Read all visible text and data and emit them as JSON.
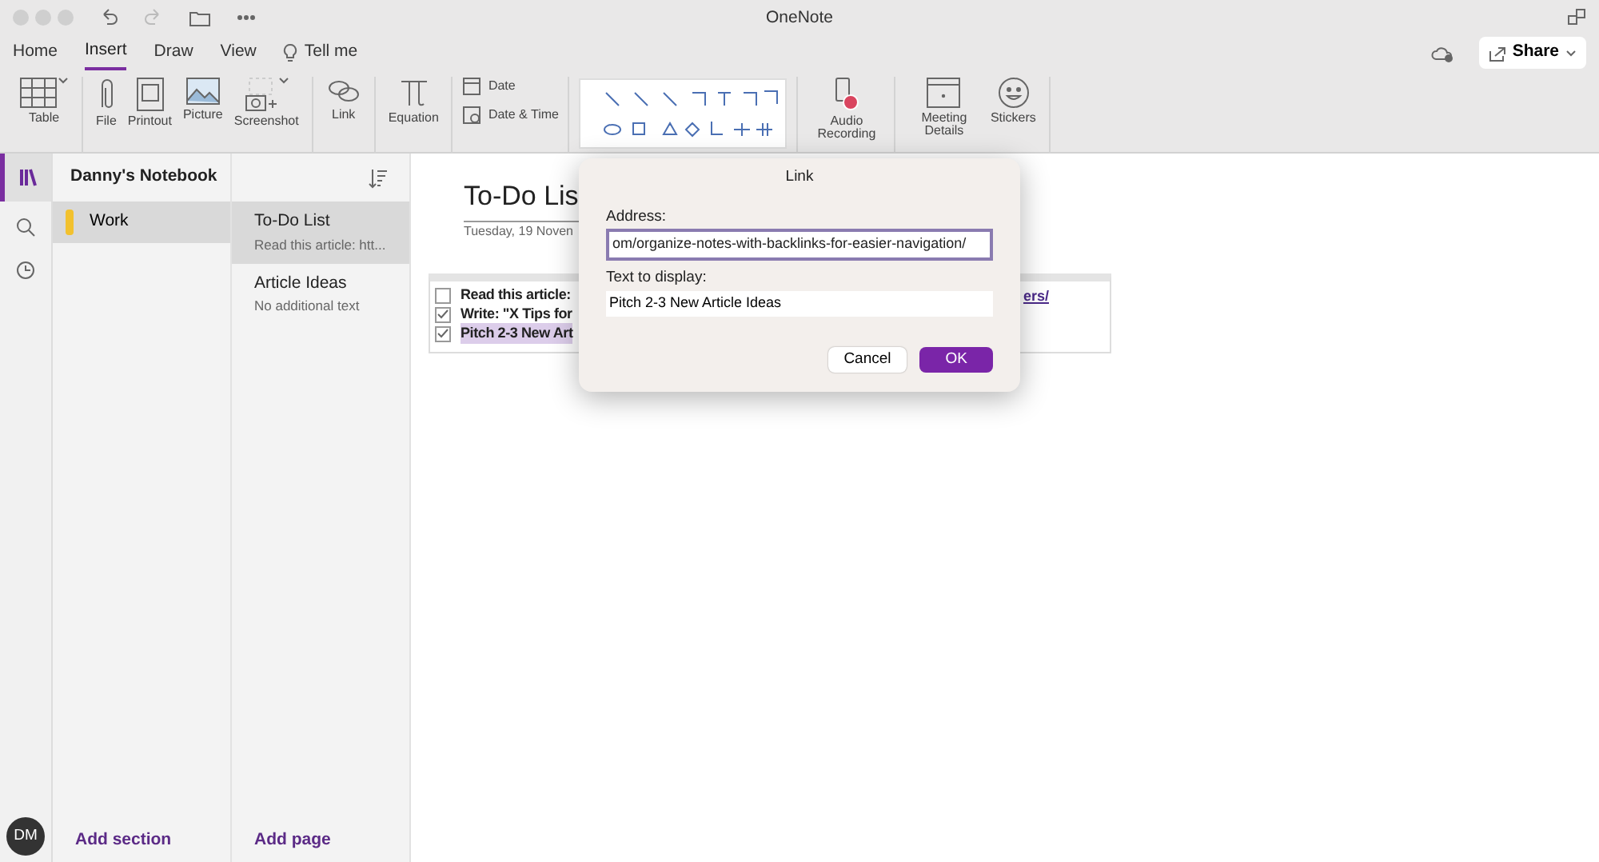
{
  "window": {
    "title": "OneNote"
  },
  "tabs": [
    {
      "label": "Home",
      "selected": false
    },
    {
      "label": "Insert",
      "selected": true
    },
    {
      "label": "Draw",
      "selected": false
    },
    {
      "label": "View",
      "selected": false
    }
  ],
  "tell_me": {
    "label": "Tell me"
  },
  "share": {
    "label": "Share"
  },
  "ribbon": [
    {
      "kind": "large",
      "items": [
        {
          "label": "Table",
          "dropdown": true
        }
      ]
    },
    {
      "kind": "large",
      "items": [
        {
          "label": "File"
        },
        {
          "label": "Printout"
        },
        {
          "label": "Picture"
        },
        {
          "label": "Screenshot",
          "dropdown": true
        }
      ]
    },
    {
      "kind": "large",
      "items": [
        {
          "label": "Link"
        }
      ]
    },
    {
      "kind": "large",
      "items": [
        {
          "label": "Equation"
        }
      ]
    },
    {
      "kind": "small",
      "items": [
        {
          "label": "Date"
        },
        {
          "label": "Date & Time"
        }
      ]
    },
    {
      "kind": "shapes"
    },
    {
      "kind": "large",
      "items": [
        {
          "label": "Audio Recording"
        }
      ]
    },
    {
      "kind": "large",
      "items": [
        {
          "label": "Meeting Details"
        },
        {
          "label": "Stickers"
        }
      ]
    }
  ],
  "notebook": {
    "name": "Danny's Notebook"
  },
  "sections": [
    {
      "label": "Work",
      "selected": true,
      "color": "#f2c12e"
    }
  ],
  "pages": [
    {
      "title": "To-Do List",
      "preview": "Read this article: htt...",
      "selected": true
    },
    {
      "title": "Article Ideas",
      "preview": "No additional text",
      "selected": false
    }
  ],
  "add_section": "Add section",
  "add_page": "Add page",
  "avatar": "DM",
  "page": {
    "title": "To-Do Lis",
    "date": "Tuesday, 19 Noven"
  },
  "note": {
    "items": [
      {
        "text": "Read this article:",
        "checked": false,
        "highlighted": false
      },
      {
        "text": "Write: \"X Tips for",
        "checked": true,
        "highlighted": false
      },
      {
        "text": "Pitch 2-3 New Art",
        "checked": true,
        "highlighted": true
      }
    ],
    "link_fragment": "ers/"
  },
  "dialog": {
    "title": "Link",
    "address_label": "Address:",
    "address": "om/organize-notes-with-backlinks-for-easier-navigation/",
    "text_label": "Text to display:",
    "text": "Pitch 2-3 New Article Ideas",
    "cancel": "Cancel",
    "ok": "OK"
  }
}
